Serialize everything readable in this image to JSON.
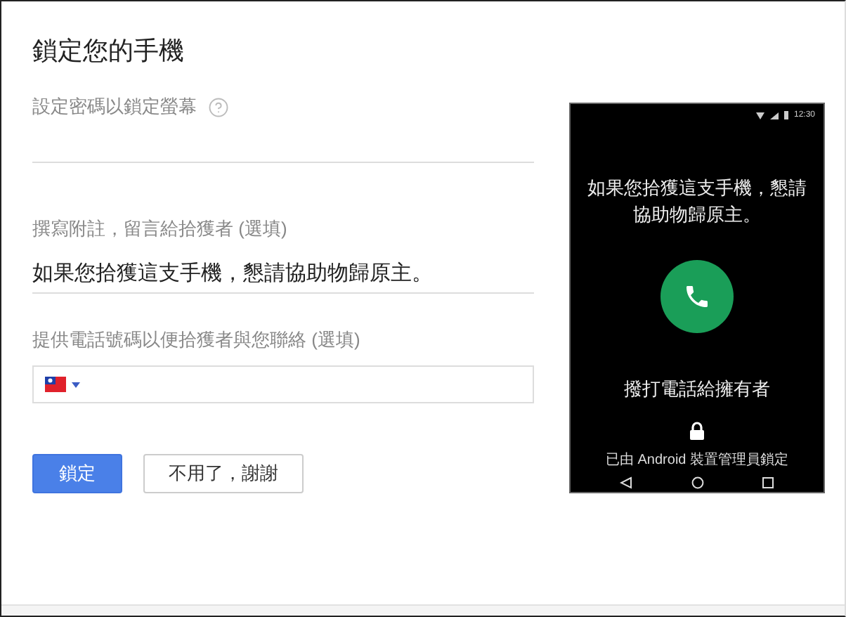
{
  "title": "鎖定您的手機",
  "password_field": {
    "label": "設定密碼以鎖定螢幕"
  },
  "note_field": {
    "label": "撰寫附註，留言給拾獲者 (選填)",
    "value": "如果您拾獲這支手機，懇請協助物歸原主。"
  },
  "phone_field": {
    "label": "提供電話號碼以便拾獲者與您聯絡 (選填)"
  },
  "phone_preview": {
    "status_time": "12:30",
    "message": "如果您拾獲這支手機，懇請協助物歸原主。",
    "call_label": "撥打電話給擁有者",
    "lock_notice": "已由 Android 裝置管理員鎖定"
  },
  "buttons": [
    {
      "label": "鎖定",
      "kind": "primary"
    },
    {
      "label": "不用了，謝謝",
      "kind": "secondary"
    }
  ]
}
